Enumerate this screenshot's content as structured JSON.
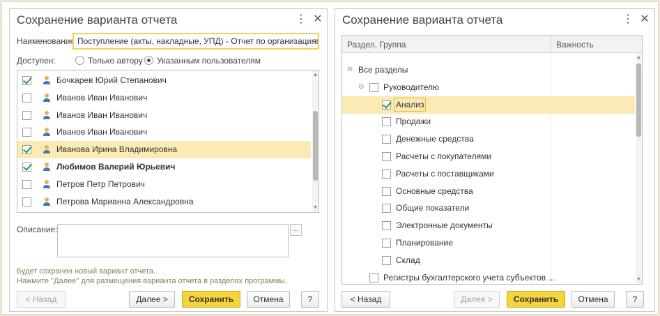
{
  "left": {
    "title": "Сохранение варианта отчета",
    "name_label": "Наименование:",
    "name_value": "Поступление (акты, накладные, УПД) - Отчет по организациям",
    "access_label": "Доступен:",
    "radio_author": "Только автору",
    "radio_users": "Указанным пользователям",
    "users": [
      {
        "name": "Бочкарев Юрий Степанович",
        "checked": true
      },
      {
        "name": "Иванов Иван Иванович",
        "checked": false
      },
      {
        "name": "Иванов Иван Иванович",
        "checked": false
      },
      {
        "name": "Иванов Иван Иванович",
        "checked": false
      },
      {
        "name": "Иванова Ирина Владимировна",
        "checked": true
      },
      {
        "name": "Любимов Валерий Юрьевич",
        "checked": true
      },
      {
        "name": "Петров Петр Петрович",
        "checked": false
      },
      {
        "name": "Петрова Марианна Александровна",
        "checked": false
      }
    ],
    "description_label": "Описание:",
    "dots": "...",
    "info_line1": "Будет сохранен новый вариант отчета.",
    "info_line2": "Нажмите \"Далее\" для размещения варианта отчета в разделах программы.",
    "btn_back": "< Назад",
    "btn_next": "Далее >",
    "btn_save": "Сохранить",
    "btn_cancel": "Отмена",
    "btn_help": "?"
  },
  "right": {
    "title": "Сохранение варианта отчета",
    "col_section": "Раздел, Группа",
    "col_importance": "Важность",
    "tree": [
      {
        "label": "Все разделы",
        "level": 0,
        "checkbox": false,
        "toggle": "⊖"
      },
      {
        "label": "Руководителю",
        "level": 1,
        "checkbox": true,
        "checked": false,
        "toggle": "⊖"
      },
      {
        "label": "Анализ",
        "level": 2,
        "checkbox": true,
        "checked": true
      },
      {
        "label": "Продажи",
        "level": 2,
        "checkbox": true,
        "checked": false
      },
      {
        "label": "Денежные средства",
        "level": 2,
        "checkbox": true,
        "checked": false
      },
      {
        "label": "Расчеты с покупателями",
        "level": 2,
        "checkbox": true,
        "checked": false
      },
      {
        "label": "Расчеты с поставщиками",
        "level": 2,
        "checkbox": true,
        "checked": false
      },
      {
        "label": "Основные средства",
        "level": 2,
        "checkbox": true,
        "checked": false
      },
      {
        "label": "Общие показатели",
        "level": 2,
        "checkbox": true,
        "checked": false
      },
      {
        "label": "Электронные документы",
        "level": 2,
        "checkbox": true,
        "checked": false
      },
      {
        "label": "Планирование",
        "level": 2,
        "checkbox": true,
        "checked": false
      },
      {
        "label": "Склад",
        "level": 2,
        "checkbox": true,
        "checked": false
      },
      {
        "label": "Регистры бухгалтерского учета субъектов ...",
        "level": 1,
        "checkbox": true,
        "checked": false
      }
    ],
    "btn_back": "< Назад",
    "btn_next": "Далее >",
    "btn_save": "Сохранить",
    "btn_cancel": "Отмена",
    "btn_help": "?"
  },
  "colors": {
    "accent": "#f5d43c",
    "selection": "#fbeab3",
    "check": "#2e9b4c"
  },
  "icons": {
    "more": "more-vertical-icon",
    "close": "close-icon",
    "user": "user-icon"
  }
}
